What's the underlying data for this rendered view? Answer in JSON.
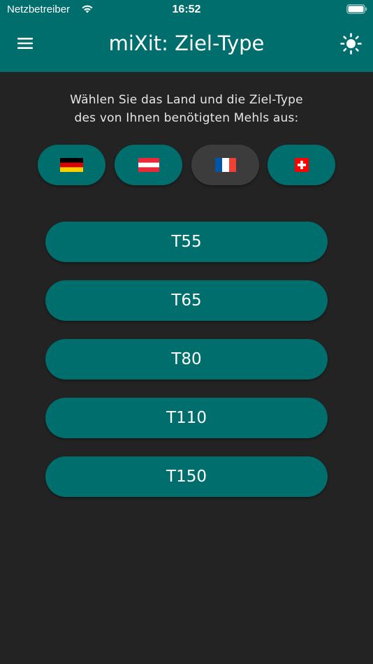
{
  "status_bar": {
    "carrier": "Netzbetreiber",
    "time": "16:52",
    "wifi_icon": "wifi-icon",
    "battery_icon": "battery-icon"
  },
  "app_bar": {
    "title": "miXit: Ziel-Type",
    "menu_icon": "hamburger-menu-icon",
    "theme_icon": "sun-icon",
    "background_color": "#016e6e"
  },
  "instruction": {
    "line1": "Wählen Sie das Land und die Ziel-Type",
    "line2": "des von Ihnen benötigten Mehls aus:"
  },
  "countries": [
    {
      "id": "de",
      "flag_icon": "germany-flag-icon",
      "selected": false
    },
    {
      "id": "at",
      "flag_icon": "austria-flag-icon",
      "selected": false
    },
    {
      "id": "fr",
      "flag_icon": "france-flag-icon",
      "selected": true
    },
    {
      "id": "ch",
      "flag_icon": "switzerland-flag-icon",
      "selected": false
    }
  ],
  "flour_types": [
    {
      "label": "T55"
    },
    {
      "label": "T65"
    },
    {
      "label": "T80"
    },
    {
      "label": "T110"
    },
    {
      "label": "T150"
    }
  ],
  "colors": {
    "accent": "#016e6e",
    "background": "#232323",
    "selected_chip": "#3c3c3c"
  }
}
